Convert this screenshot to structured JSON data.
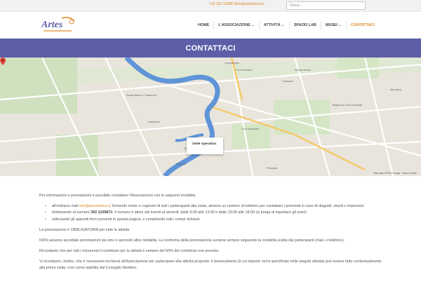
{
  "topbar": {
    "phone": "+39 392 1109871",
    "email": "info@artesfarino.it",
    "search_placeholder": "Cerca..."
  },
  "header": {
    "logo_text": "Artes",
    "nav": [
      {
        "label": "HOME"
      },
      {
        "label": "L'ASSOCIAZIONE ⌄"
      },
      {
        "label": "ATTIVITÀ ⌄"
      },
      {
        "label": "SPAZIO LAB"
      },
      {
        "label": "MUSEI ⌄"
      },
      {
        "label": "CONTATTACI"
      }
    ]
  },
  "banner": {
    "title": "CONTATTACI"
  },
  "map": {
    "popup_title": "Sede operativa",
    "labels": [
      "Campidoglio",
      "Foro Romano",
      "Colosseo",
      "Domus Aurea",
      "Basilica di San Clemente",
      "Circo Massimo",
      "Trastevere",
      "Testaccio",
      "Piramide",
      "Merulana",
      "Santa Maria in Trastevere",
      "Giardino degli Aranci"
    ],
    "attribution": "Map data ©2016 Google · Terms of Use"
  },
  "content": {
    "intro": "Per informazioni e prenotazioni è possibile contattare l'Associazione con le seguenti modalità:",
    "bullets": [
      {
        "pre": "all'indirizzo mail ",
        "link": "info@artesfarino.it",
        "post": ", fornendo nome e cognomi di tutti i partecipanti alla visita, almeno un numero di telefono per contattare i prenotati in caso di disguidi, ritardi o imprevisti;"
      },
      {
        "pre": "telefonando al numero ",
        "bold": "392 1109871",
        "post": ": il numero è attivo dal lunedì al venerdì, dalle 9:00 alle 13:00 e dalle 15:00 alle 18:00 (si prega di rispettare gli orari);"
      },
      {
        "pre": "utilizzando gli appositi form presenti in questa pagina, e compilando tutti i campi richiesti."
      }
    ],
    "paragraphs": [
      "La prenotazione è OBBLIGATORIA per tutte le attività.",
      "NON saranno accettate prenotazioni via sms o secondo altre modalità. La conferma della prenotazione avviene sempre seguendo la modalità scelta dai partecipanti (mail, o telefono).",
      "Ricordiamo che per tutti i minorenni il contributo per le attività è sempre del 50% del contributo ove previsto.",
      "Vi ricordiamo, inoltre, che è necessario iscriversi all'Associazione per partecipare alle attività proposte: il tesseramento (il cui importo verrà specificato nelle singole attività) può essere fatto contestualmente alla prima visita, così come stabilito dal Consiglio Direttivo."
    ]
  },
  "colors": {
    "accent": "#e08a2a",
    "banner": "#5c5fa8",
    "river": "#5f94d8"
  }
}
